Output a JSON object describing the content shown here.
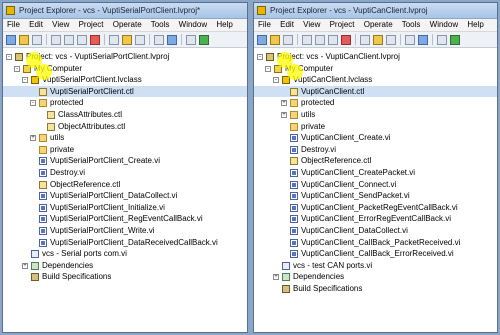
{
  "left": {
    "title": "Project Explorer - vcs - VuptiSerialPortClient.lvproj*",
    "menu": [
      "File",
      "Edit",
      "View",
      "Project",
      "Operate",
      "Tools",
      "Window",
      "Help"
    ],
    "tree": [
      {
        "indent": 0,
        "icon": "project",
        "text": "Project: vcs - VuptiSerialPortClient.lvproj",
        "expander": "-"
      },
      {
        "indent": 1,
        "icon": "computer",
        "text": "My Computer",
        "expander": "-"
      },
      {
        "indent": 2,
        "icon": "class",
        "text": "VuptiSerialPortClient.lvclass",
        "expander": "-"
      },
      {
        "indent": 3,
        "icon": "ctl",
        "text": "VuptiSerialPortClient.ctl",
        "selected": true
      },
      {
        "indent": 3,
        "icon": "folder",
        "text": "protected",
        "expander": "-"
      },
      {
        "indent": 4,
        "icon": "ctl",
        "text": "ClassAttributes.ctl"
      },
      {
        "indent": 4,
        "icon": "ctl",
        "text": "ObjectAttributes.ctl"
      },
      {
        "indent": 3,
        "icon": "folder",
        "text": "utils",
        "expander": "+"
      },
      {
        "indent": 3,
        "icon": "folder",
        "text": "private"
      },
      {
        "indent": 3,
        "icon": "vi",
        "text": "VuptiSerialPortClient_Create.vi"
      },
      {
        "indent": 3,
        "icon": "vi",
        "text": "Destroy.vi"
      },
      {
        "indent": 3,
        "icon": "ctl",
        "text": "ObjectReference.ctl"
      },
      {
        "indent": 3,
        "icon": "vi",
        "text": "VuptiSerialPortClient_DataCollect.vi"
      },
      {
        "indent": 3,
        "icon": "vi",
        "text": "VuptiSerialPortClient_Initialize.vi"
      },
      {
        "indent": 3,
        "icon": "vi",
        "text": "VuptiSerialPortClient_RegEventCallBack.vi"
      },
      {
        "indent": 3,
        "icon": "vi",
        "text": "VuptiSerialPortClient_Write.vi"
      },
      {
        "indent": 3,
        "icon": "vi",
        "text": "VuptiSerialPortClient_DataReceivedCallBack.vi"
      },
      {
        "indent": 2,
        "icon": "vi2",
        "text": "vcs - Serial ports com.vi"
      },
      {
        "indent": 2,
        "icon": "dep",
        "text": "Dependencies",
        "expander": "+"
      },
      {
        "indent": 2,
        "icon": "build",
        "text": "Build Specifications"
      }
    ]
  },
  "right": {
    "title": "Project Explorer - vcs - VuptiCanClient.lvproj",
    "menu": [
      "File",
      "Edit",
      "View",
      "Project",
      "Operate",
      "Tools",
      "Window",
      "Help"
    ],
    "tree": [
      {
        "indent": 0,
        "icon": "project",
        "text": "Project: vcs - VuptiCanClient.lvproj",
        "expander": "-"
      },
      {
        "indent": 1,
        "icon": "computer",
        "text": "My Computer",
        "expander": "-"
      },
      {
        "indent": 2,
        "icon": "class",
        "text": "VuptiCanClient.lvclass",
        "expander": "-"
      },
      {
        "indent": 3,
        "icon": "ctl",
        "text": "VuptiCanClient.ctl",
        "selected": true
      },
      {
        "indent": 3,
        "icon": "folder",
        "text": "protected",
        "expander": "+"
      },
      {
        "indent": 3,
        "icon": "folder",
        "text": "utils",
        "expander": "+"
      },
      {
        "indent": 3,
        "icon": "folder",
        "text": "private"
      },
      {
        "indent": 3,
        "icon": "vi",
        "text": "VuptiCanClient_Create.vi"
      },
      {
        "indent": 3,
        "icon": "vi",
        "text": "Destroy.vi"
      },
      {
        "indent": 3,
        "icon": "ctl",
        "text": "ObjectReference.ctl"
      },
      {
        "indent": 3,
        "icon": "vi",
        "text": "VuptiCanClient_CreatePacket.vi"
      },
      {
        "indent": 3,
        "icon": "vi",
        "text": "VuptiCanClient_Connect.vi"
      },
      {
        "indent": 3,
        "icon": "vi",
        "text": "VuptiCanClient_SendPacket.vi"
      },
      {
        "indent": 3,
        "icon": "vi",
        "text": "VuptiCanClient_PacketRegEventCallBack.vi"
      },
      {
        "indent": 3,
        "icon": "vi",
        "text": "VuptiCanClient_ErrorRegEventCallBack.vi"
      },
      {
        "indent": 3,
        "icon": "vi",
        "text": "VuptiCanClient_DataCollect.vi"
      },
      {
        "indent": 3,
        "icon": "vi",
        "text": "VuptiCanClient_CallBack_PacketReceived.vi"
      },
      {
        "indent": 3,
        "icon": "vi",
        "text": "VuptiCanClient_CallBack_ErrorReceived.vi"
      },
      {
        "indent": 2,
        "icon": "vi2",
        "text": "vcs - test CAN ports.vi"
      },
      {
        "indent": 2,
        "icon": "dep",
        "text": "Dependencies",
        "expander": "+"
      },
      {
        "indent": 2,
        "icon": "build",
        "text": "Build Specifications"
      }
    ]
  }
}
